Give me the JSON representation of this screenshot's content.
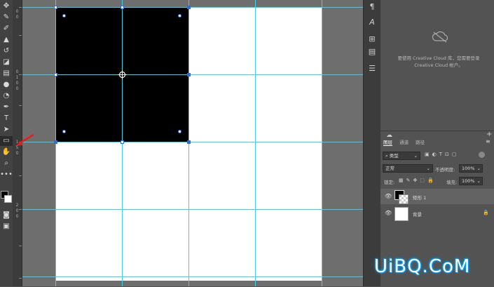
{
  "toolbar": {
    "tools": [
      "move-tool",
      "marquee-tool",
      "lasso-tool",
      "magic-wand-tool",
      "crop-tool",
      "eyedropper-tool",
      "healing-brush-tool",
      "brush-tool",
      "clone-stamp-tool",
      "history-brush-tool",
      "eraser-tool",
      "gradient-tool",
      "blur-tool",
      "dodge-tool",
      "pen-tool",
      "type-tool",
      "path-selection-tool",
      "rectangle-tool",
      "hand-tool",
      "zoom-tool",
      "more-tools",
      "color-swatches",
      "quick-mask",
      "screen-mode"
    ]
  },
  "ruler": {
    "ticks": [
      "0",
      "0",
      "0",
      "1",
      "0",
      "0",
      "1",
      "5",
      "0",
      "2",
      "0",
      "0"
    ]
  },
  "cc_panel": {
    "message": "要使用 Creative Cloud 库，您需要登录 Creative Cloud 帐户。"
  },
  "layers_panel": {
    "tabs": [
      "图层",
      "通道",
      "路径"
    ],
    "filter_label": "类型",
    "blend_mode": "正常",
    "opacity_label": "不透明度:",
    "opacity_value": "100%",
    "lock_label": "锁定:",
    "fill_label": "填充:",
    "fill_value": "100%",
    "layers": [
      {
        "name": "矩形 1"
      },
      {
        "name": "背景"
      }
    ]
  },
  "watermark": "UiBQ.CoM",
  "colors": {
    "guide": "#39d2e6",
    "handle": "#2d6dd6",
    "shape_fill": "#000000"
  }
}
